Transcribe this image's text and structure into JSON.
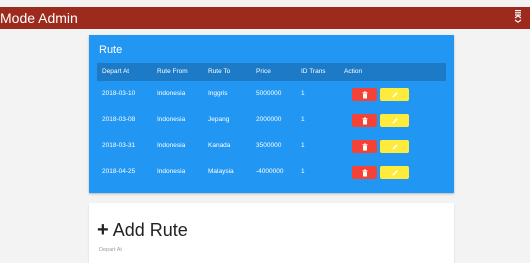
{
  "app": {
    "title": "Mode Admin"
  },
  "colors": {
    "topbar": "#9c2a1d",
    "card": "#2196f3",
    "table_header": "#1d7ac7",
    "delete": "#f44336",
    "edit": "#ffeb3b"
  },
  "rute_table": {
    "title": "Rute",
    "columns": [
      "Depart At",
      "Rute From",
      "Rute To",
      "Price",
      "ID Trans",
      "Action"
    ],
    "rows": [
      {
        "depart_at": "2018-03-10",
        "rute_from": "Indonesia",
        "rute_to": "Inggris",
        "price": "5000000",
        "id_trans": "1"
      },
      {
        "depart_at": "2018-03-08",
        "rute_from": "Indonesia",
        "rute_to": "Jepang",
        "price": "2000000",
        "id_trans": "1"
      },
      {
        "depart_at": "2018-03-31",
        "rute_from": "Indonesia",
        "rute_to": "Kanada",
        "price": "3500000",
        "id_trans": "1"
      },
      {
        "depart_at": "2018-04-25",
        "rute_from": "Indonesia",
        "rute_to": "Malaysia",
        "price": "-4000000",
        "id_trans": "1"
      }
    ],
    "action_icons": {
      "delete": "trash-icon",
      "edit": "pencil-icon"
    }
  },
  "add_rute": {
    "plus": "+",
    "title": "Add Rute",
    "field_label": "Depart At"
  },
  "icons": {
    "menu": "menu-toggle-icon"
  }
}
